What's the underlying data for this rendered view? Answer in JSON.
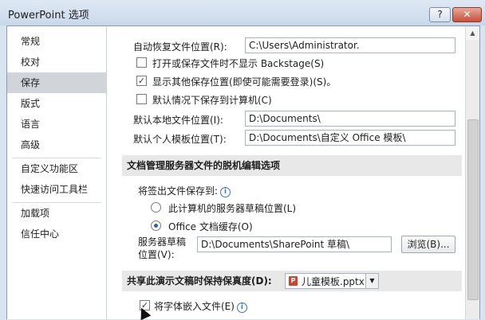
{
  "window": {
    "title": "PowerPoint 选项",
    "help": "?",
    "close": "✕"
  },
  "sidebar": {
    "items": [
      "常规",
      "校对",
      "保存",
      "版式",
      "语言",
      "高级",
      "自定义功能区",
      "快速访问工具栏",
      "加载项",
      "信任中心"
    ],
    "selected": "保存"
  },
  "save": {
    "autorecover_label": "自动恢复文件位置(R):",
    "autorecover_value": "C:\\Users\\Administrator.",
    "no_backstage_label": "打开或保存文件时不显示 Backstage(S)",
    "no_backstage_checked": false,
    "show_locations_label": "显示其他保存位置(即使可能需要登录)(S)。",
    "show_locations_checked": true,
    "default_computer_label": "默认情况下保存到计算机(C)",
    "default_computer_checked": false,
    "local_location_label": "默认本地文件位置(I):",
    "local_location_value": "D:\\Documents\\",
    "template_location_label": "默认个人模板位置(T):",
    "template_location_value": "D:\\Documents\\自定义 Office 模板\\"
  },
  "offline": {
    "header": "文档管理服务器文件的脱机编辑选项",
    "save_to_label": "将签出文件保存到:",
    "radio_server": "此计算机的服务器草稿位置(L)",
    "radio_server_selected": false,
    "radio_cache": "Office 文档缓存(O)",
    "radio_cache_selected": true,
    "drafts_label_line1": "服务器草稿",
    "drafts_label_line2": "位置(V):",
    "drafts_value": "D:\\Documents\\SharePoint 草稿\\",
    "browse_button": "浏览(B)..."
  },
  "fidelity": {
    "header": "共享此演示文稿时保持保真度(D):",
    "doc_icon": "P",
    "doc_name": "儿童模板.pptx",
    "embed_fonts_label": "将字体嵌入文件(E)",
    "embed_fonts_checked": true
  }
}
